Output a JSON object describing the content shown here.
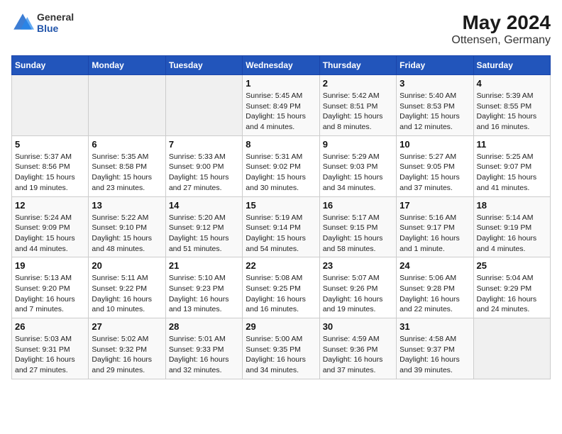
{
  "header": {
    "logo_line1": "General",
    "logo_line2": "Blue",
    "title": "May 2024",
    "subtitle": "Ottensen, Germany"
  },
  "days_of_week": [
    "Sunday",
    "Monday",
    "Tuesday",
    "Wednesday",
    "Thursday",
    "Friday",
    "Saturday"
  ],
  "weeks": [
    [
      {
        "day": "",
        "info": ""
      },
      {
        "day": "",
        "info": ""
      },
      {
        "day": "",
        "info": ""
      },
      {
        "day": "1",
        "info": "Sunrise: 5:45 AM\nSunset: 8:49 PM\nDaylight: 15 hours\nand 4 minutes."
      },
      {
        "day": "2",
        "info": "Sunrise: 5:42 AM\nSunset: 8:51 PM\nDaylight: 15 hours\nand 8 minutes."
      },
      {
        "day": "3",
        "info": "Sunrise: 5:40 AM\nSunset: 8:53 PM\nDaylight: 15 hours\nand 12 minutes."
      },
      {
        "day": "4",
        "info": "Sunrise: 5:39 AM\nSunset: 8:55 PM\nDaylight: 15 hours\nand 16 minutes."
      }
    ],
    [
      {
        "day": "5",
        "info": "Sunrise: 5:37 AM\nSunset: 8:56 PM\nDaylight: 15 hours\nand 19 minutes."
      },
      {
        "day": "6",
        "info": "Sunrise: 5:35 AM\nSunset: 8:58 PM\nDaylight: 15 hours\nand 23 minutes."
      },
      {
        "day": "7",
        "info": "Sunrise: 5:33 AM\nSunset: 9:00 PM\nDaylight: 15 hours\nand 27 minutes."
      },
      {
        "day": "8",
        "info": "Sunrise: 5:31 AM\nSunset: 9:02 PM\nDaylight: 15 hours\nand 30 minutes."
      },
      {
        "day": "9",
        "info": "Sunrise: 5:29 AM\nSunset: 9:03 PM\nDaylight: 15 hours\nand 34 minutes."
      },
      {
        "day": "10",
        "info": "Sunrise: 5:27 AM\nSunset: 9:05 PM\nDaylight: 15 hours\nand 37 minutes."
      },
      {
        "day": "11",
        "info": "Sunrise: 5:25 AM\nSunset: 9:07 PM\nDaylight: 15 hours\nand 41 minutes."
      }
    ],
    [
      {
        "day": "12",
        "info": "Sunrise: 5:24 AM\nSunset: 9:09 PM\nDaylight: 15 hours\nand 44 minutes."
      },
      {
        "day": "13",
        "info": "Sunrise: 5:22 AM\nSunset: 9:10 PM\nDaylight: 15 hours\nand 48 minutes."
      },
      {
        "day": "14",
        "info": "Sunrise: 5:20 AM\nSunset: 9:12 PM\nDaylight: 15 hours\nand 51 minutes."
      },
      {
        "day": "15",
        "info": "Sunrise: 5:19 AM\nSunset: 9:14 PM\nDaylight: 15 hours\nand 54 minutes."
      },
      {
        "day": "16",
        "info": "Sunrise: 5:17 AM\nSunset: 9:15 PM\nDaylight: 15 hours\nand 58 minutes."
      },
      {
        "day": "17",
        "info": "Sunrise: 5:16 AM\nSunset: 9:17 PM\nDaylight: 16 hours\nand 1 minute."
      },
      {
        "day": "18",
        "info": "Sunrise: 5:14 AM\nSunset: 9:19 PM\nDaylight: 16 hours\nand 4 minutes."
      }
    ],
    [
      {
        "day": "19",
        "info": "Sunrise: 5:13 AM\nSunset: 9:20 PM\nDaylight: 16 hours\nand 7 minutes."
      },
      {
        "day": "20",
        "info": "Sunrise: 5:11 AM\nSunset: 9:22 PM\nDaylight: 16 hours\nand 10 minutes."
      },
      {
        "day": "21",
        "info": "Sunrise: 5:10 AM\nSunset: 9:23 PM\nDaylight: 16 hours\nand 13 minutes."
      },
      {
        "day": "22",
        "info": "Sunrise: 5:08 AM\nSunset: 9:25 PM\nDaylight: 16 hours\nand 16 minutes."
      },
      {
        "day": "23",
        "info": "Sunrise: 5:07 AM\nSunset: 9:26 PM\nDaylight: 16 hours\nand 19 minutes."
      },
      {
        "day": "24",
        "info": "Sunrise: 5:06 AM\nSunset: 9:28 PM\nDaylight: 16 hours\nand 22 minutes."
      },
      {
        "day": "25",
        "info": "Sunrise: 5:04 AM\nSunset: 9:29 PM\nDaylight: 16 hours\nand 24 minutes."
      }
    ],
    [
      {
        "day": "26",
        "info": "Sunrise: 5:03 AM\nSunset: 9:31 PM\nDaylight: 16 hours\nand 27 minutes."
      },
      {
        "day": "27",
        "info": "Sunrise: 5:02 AM\nSunset: 9:32 PM\nDaylight: 16 hours\nand 29 minutes."
      },
      {
        "day": "28",
        "info": "Sunrise: 5:01 AM\nSunset: 9:33 PM\nDaylight: 16 hours\nand 32 minutes."
      },
      {
        "day": "29",
        "info": "Sunrise: 5:00 AM\nSunset: 9:35 PM\nDaylight: 16 hours\nand 34 minutes."
      },
      {
        "day": "30",
        "info": "Sunrise: 4:59 AM\nSunset: 9:36 PM\nDaylight: 16 hours\nand 37 minutes."
      },
      {
        "day": "31",
        "info": "Sunrise: 4:58 AM\nSunset: 9:37 PM\nDaylight: 16 hours\nand 39 minutes."
      },
      {
        "day": "",
        "info": ""
      }
    ]
  ]
}
